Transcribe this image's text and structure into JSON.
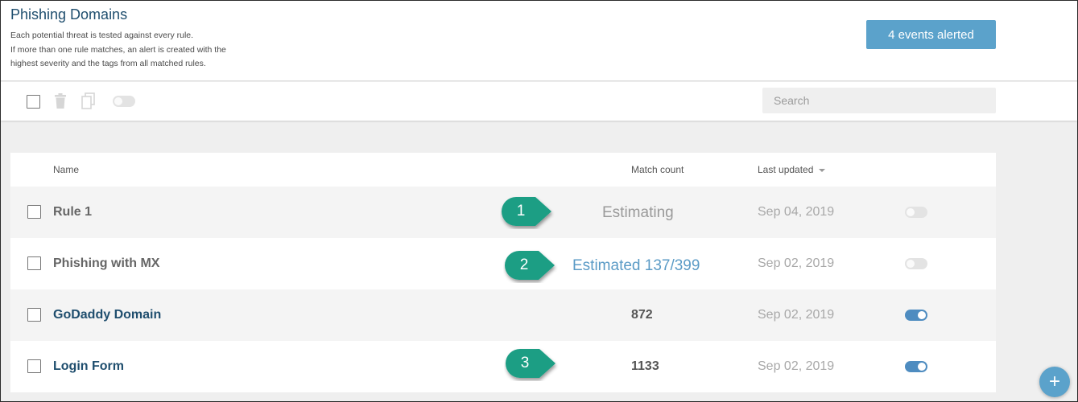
{
  "header": {
    "title": "Phishing Domains",
    "description_lines": [
      "Each potential threat is tested against every rule.",
      "If more than one rule matches, an alert is created with the",
      "highest severity and the tags from all matched rules."
    ],
    "alert_button_label": "4 events alerted"
  },
  "toolbar": {
    "search_placeholder": "Search",
    "icons": [
      "select-all-checkbox",
      "trash-icon",
      "copy-icon",
      "toggle-icon"
    ]
  },
  "table": {
    "columns": {
      "name": "Name",
      "match_count": "Match count",
      "last_updated": "Last updated"
    },
    "rows": [
      {
        "name": "Rule 1",
        "match_count": "",
        "last_updated": "Sep 04, 2019",
        "enabled": false
      },
      {
        "name": "Phishing with MX",
        "match_count": "",
        "last_updated": "Sep 02, 2019",
        "enabled": false
      },
      {
        "name": "GoDaddy Domain",
        "match_count": "872",
        "last_updated": "Sep 02, 2019",
        "enabled": true
      },
      {
        "name": "Login Form",
        "match_count": "1133",
        "last_updated": "Sep 02, 2019",
        "enabled": true
      }
    ]
  },
  "annotations": {
    "callouts": [
      "1",
      "2",
      "3"
    ],
    "estimating": "Estimating",
    "estimated": "Estimated 137/399"
  },
  "colors": {
    "accent": "#5ba2cb",
    "callout_green": "#1a9e84",
    "toggle_on": "#4e8cc0",
    "title_blue": "#1f4e6e"
  },
  "fab": {
    "icon": "plus-icon",
    "label": "+"
  }
}
